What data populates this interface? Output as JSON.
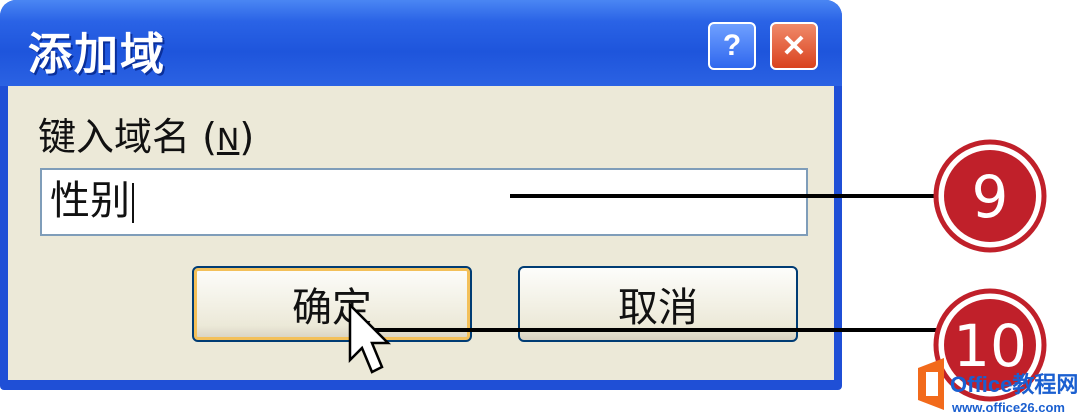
{
  "dialog": {
    "title": "添加域",
    "help_label": "?",
    "close_label": "✕",
    "prompt_label": "键入域名 (",
    "prompt_accel": "N",
    "prompt_close": ")",
    "field_value": "性别",
    "ok_label": "确定",
    "cancel_label": "取消"
  },
  "annotations": {
    "step_field": "9",
    "step_ok": "10"
  },
  "watermark": {
    "brand": "Office教程网",
    "url": "www.office26.com"
  },
  "colors": {
    "titlebar": "#1f4fd6",
    "client": "#ece9d8",
    "callout_red": "#c0202a",
    "watermark_orange": "#f26a1b"
  }
}
